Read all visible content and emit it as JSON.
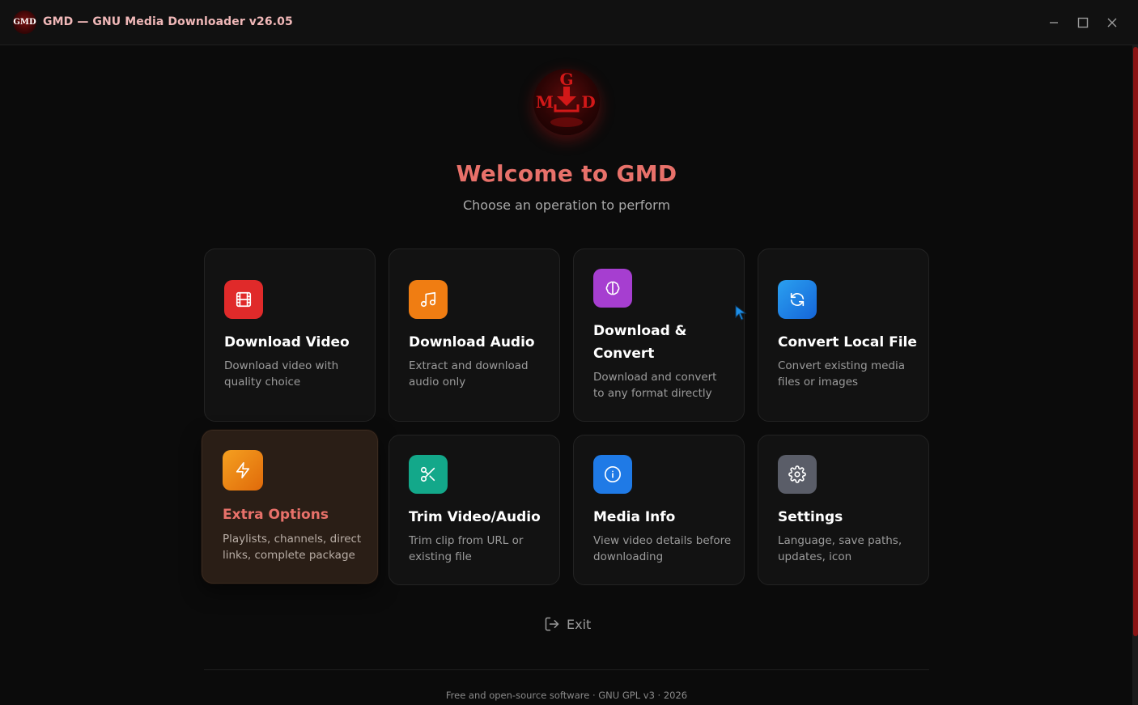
{
  "window": {
    "title": "GMD — GNU Media Downloader v26.05",
    "icon_text": "GMD"
  },
  "header": {
    "welcome": "Welcome to GMD",
    "subtitle": "Choose an operation to perform"
  },
  "cards": [
    {
      "title": "Download Video",
      "desc": "Download video with quality choice",
      "icon": "film-icon",
      "color": "#e02a2a"
    },
    {
      "title": "Download Audio",
      "desc": "Extract and download audio only",
      "icon": "music-note-icon",
      "color": "#f07d12"
    },
    {
      "title": "Download & Convert",
      "desc": "Download and convert to any format directly",
      "icon": "brain-icon",
      "color": "#a63ed0"
    },
    {
      "title": "Convert Local File",
      "desc": "Convert existing media files or images",
      "icon": "refresh-icon",
      "color": "#1e90e6"
    },
    {
      "title": "Extra Options",
      "desc": "Playlists, channels, direct links, complete package",
      "icon": "lightning-icon",
      "color": "#f28a12"
    },
    {
      "title": "Trim Video/Audio",
      "desc": "Trim clip from URL or existing file",
      "icon": "scissors-icon",
      "color": "#13a88a"
    },
    {
      "title": "Media Info",
      "desc": "View video details before downloading",
      "icon": "info-icon",
      "color": "#1f7ae6"
    },
    {
      "title": "Settings",
      "desc": "Language, save paths, updates, icon",
      "icon": "gear-icon",
      "color": "#5a5d68"
    }
  ],
  "exit_label": "Exit",
  "footer": "Free and open-source software · GNU GPL v3 · 2026",
  "colors": {
    "accent": "#e8716a",
    "background": "#0b0b0b",
    "card": "#121212",
    "brand_red": "#8a1414"
  }
}
